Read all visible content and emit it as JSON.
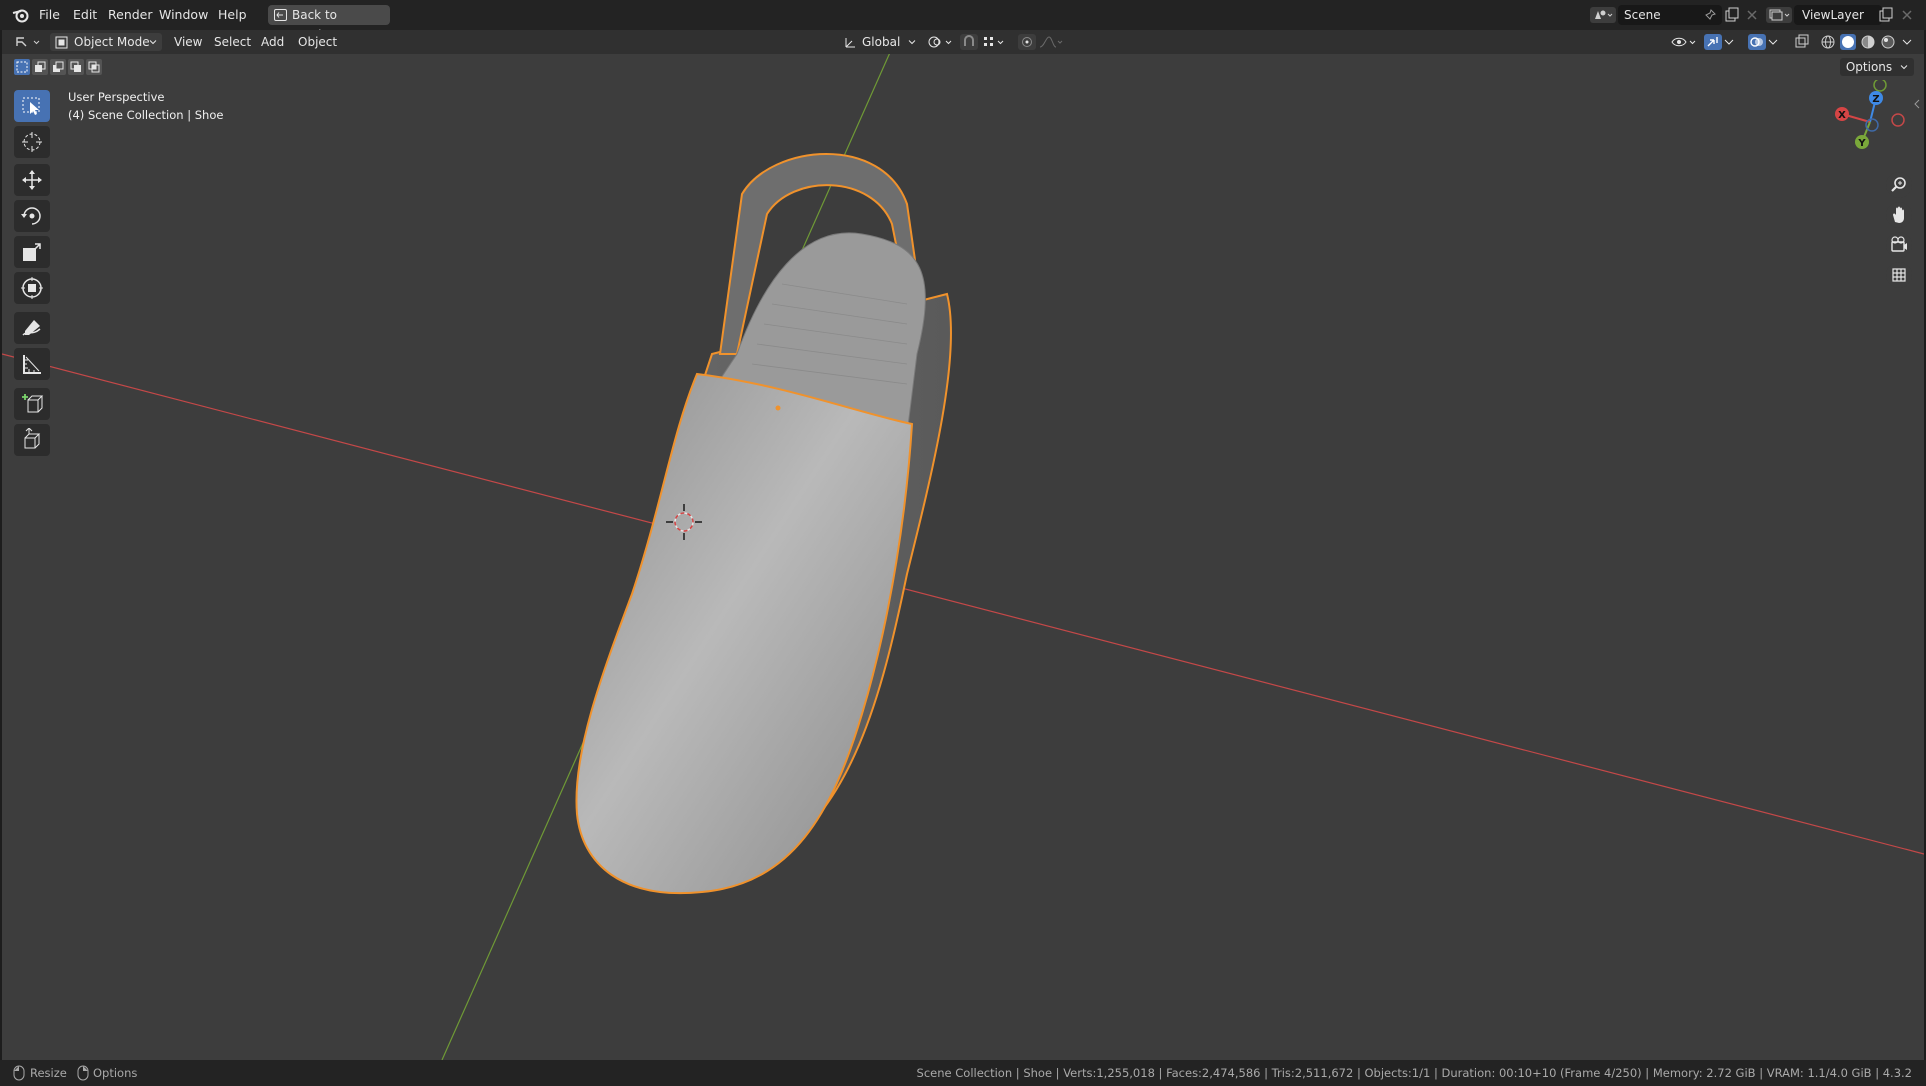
{
  "menubar": {
    "items": [
      "File",
      "Edit",
      "Render",
      "Window",
      "Help"
    ],
    "back_label": "Back to Previous",
    "scene_name": "Scene",
    "view_layer": "ViewLayer"
  },
  "header": {
    "mode": "Object Mode",
    "menus": [
      "View",
      "Select",
      "Add",
      "Object"
    ],
    "orientation": "Global",
    "options": "Options"
  },
  "viewport": {
    "perspective": "User Perspective",
    "collection": "(4) Scene Collection | Shoe",
    "gizmo": {
      "x": "X",
      "y": "Y",
      "z": "Z"
    }
  },
  "statusbar": {
    "left_resize": "Resize",
    "left_options": "Options",
    "info": "Scene Collection | Shoe | Verts:1,255,018 | Faces:2,474,586 | Tris:2,511,672 | Objects:1/1 | Duration: 00:10+10 (Frame 4/250) | Memory: 2.72 GiB | VRAM: 1.1/4.0 GiB | 4.3.2"
  },
  "colors": {
    "accent": "#4772b3",
    "selection_outline": "#f0922c",
    "x_axis": "#d64545",
    "y_axis": "#7aa83a",
    "z_axis": "#3f8ae6"
  }
}
